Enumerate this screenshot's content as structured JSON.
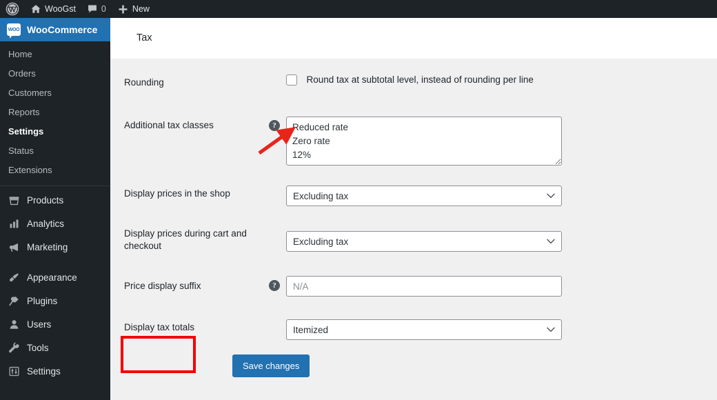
{
  "adminbar": {
    "wp_logo": "wordpress-logo-icon",
    "site_name": "WooGst",
    "home_icon": "home-icon",
    "comments_icon": "comment-bubble-icon",
    "comments_count": "0",
    "new_icon": "plus-icon",
    "new_label": "New"
  },
  "sidebar": {
    "current": {
      "label": "WooCommerce",
      "badge_text": "WOO",
      "badge_icon": "woocommerce-badge-icon"
    },
    "submenu": [
      {
        "label": "Home",
        "active": false
      },
      {
        "label": "Orders",
        "active": false
      },
      {
        "label": "Customers",
        "active": false
      },
      {
        "label": "Reports",
        "active": false
      },
      {
        "label": "Settings",
        "active": true
      },
      {
        "label": "Status",
        "active": false
      },
      {
        "label": "Extensions",
        "active": false
      }
    ],
    "menu_group_1": [
      {
        "label": "Products",
        "icon": "products-icon"
      },
      {
        "label": "Analytics",
        "icon": "analytics-bars-icon"
      },
      {
        "label": "Marketing",
        "icon": "megaphone-icon"
      }
    ],
    "menu_group_2": [
      {
        "label": "Appearance",
        "icon": "paintbrush-icon"
      },
      {
        "label": "Plugins",
        "icon": "plug-icon"
      },
      {
        "label": "Users",
        "icon": "user-icon"
      },
      {
        "label": "Tools",
        "icon": "wrench-icon"
      },
      {
        "label": "Settings",
        "icon": "sliders-icon"
      }
    ]
  },
  "header": {
    "title": "Tax"
  },
  "form": {
    "rounding": {
      "label": "Rounding",
      "checkbox_label": "Round tax at subtotal level, instead of rounding per line",
      "checked": false
    },
    "additional_tax_classes": {
      "label": "Additional tax classes",
      "help_icon": "help-question-icon",
      "value": "Reduced rate\nZero rate\n12%"
    },
    "display_prices_shop": {
      "label": "Display prices in the shop",
      "value": "Excluding tax",
      "chevron_icon": "chevron-down-icon"
    },
    "display_prices_cart": {
      "label": "Display prices during cart and checkout",
      "value": "Excluding tax",
      "chevron_icon": "chevron-down-icon"
    },
    "price_display_suffix": {
      "label": "Price display suffix",
      "help_icon": "help-question-icon",
      "value": "",
      "placeholder": "N/A"
    },
    "display_tax_totals": {
      "label": "Display tax totals",
      "value": "Itemized",
      "chevron_icon": "chevron-down-icon"
    },
    "save_label": "Save changes"
  },
  "annotations": {
    "arrow_icon": "red-arrow-pointer",
    "arrow_color": "#e8251b",
    "highlight_color": "#f40000"
  },
  "colors": {
    "admin_dark": "#1d2327",
    "accent_blue": "#2271b1",
    "content_bg": "#f0f0f1"
  }
}
